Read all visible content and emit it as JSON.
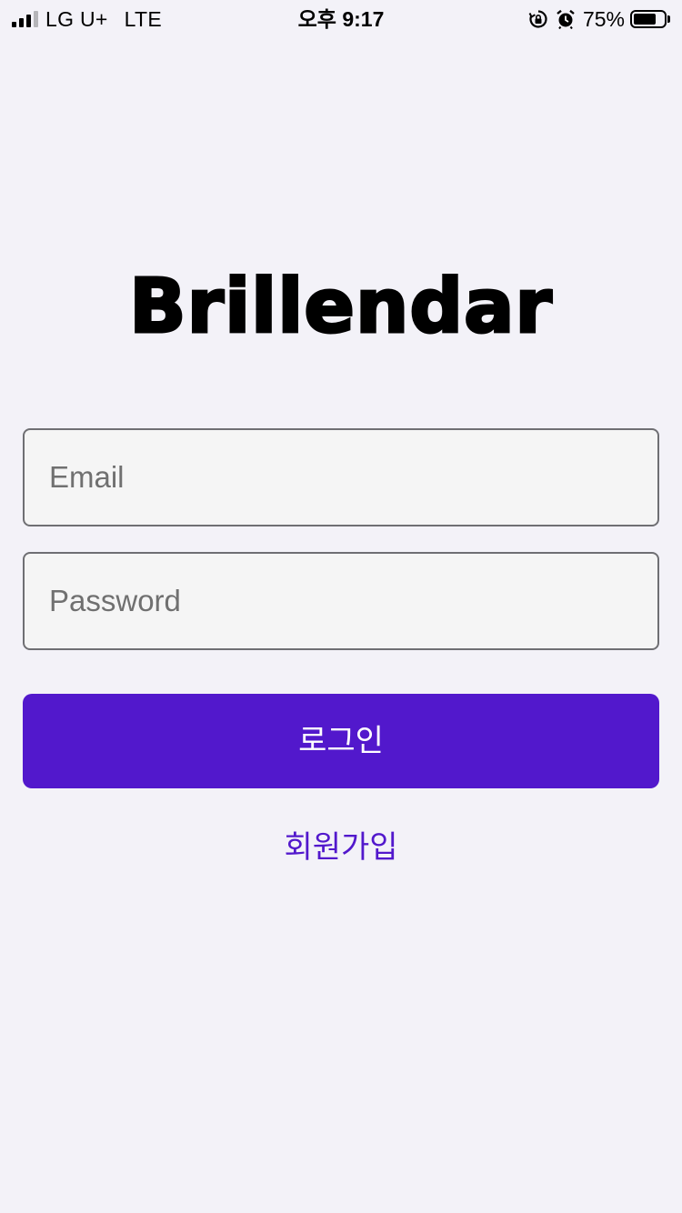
{
  "status_bar": {
    "carrier": "LG U+",
    "network": "LTE",
    "time": "오후 9:17",
    "battery_percent": "75%",
    "battery_level": 0.75,
    "signal_bars_active": 3,
    "signal_bars_total": 4,
    "icons": [
      "signal-icon",
      "rotation-lock-icon",
      "alarm-icon",
      "battery-icon"
    ]
  },
  "app": {
    "logo_text": "Brillendar"
  },
  "login_form": {
    "email": {
      "placeholder": "Email",
      "value": ""
    },
    "password": {
      "placeholder": "Password",
      "value": ""
    },
    "login_button_label": "로그인",
    "signup_label": "회원가입"
  },
  "colors": {
    "background": "#f3f2f8",
    "accent": "#5218cc",
    "field_background": "#f5f5f5",
    "field_border": "#6f6f73"
  }
}
